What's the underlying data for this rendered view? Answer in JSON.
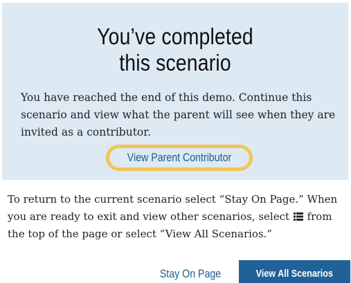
{
  "modal": {
    "title_line1": "You’ve completed",
    "title_line2": "this scenario",
    "message": "You have reached the end of this demo. Continue this scenario and view what the parent will see when they are invited as a contributor.",
    "parent_link_label": "View Parent Contributor"
  },
  "info": {
    "text_before_icon": "To return to the current scenario select “Stay On Page.” When you are ready to exit and view other scenarios, select ",
    "icon": "list-icon",
    "text_after_icon": " from the top of the page or select “View All Scenarios.”"
  },
  "actions": {
    "stay_label": "Stay On Page",
    "view_all_label": "View All Scenarios"
  },
  "colors": {
    "panel_bg": "#dde9f3",
    "link": "#1d5d8b",
    "highlight": "#f3c555",
    "primary_button": "#20619a"
  }
}
